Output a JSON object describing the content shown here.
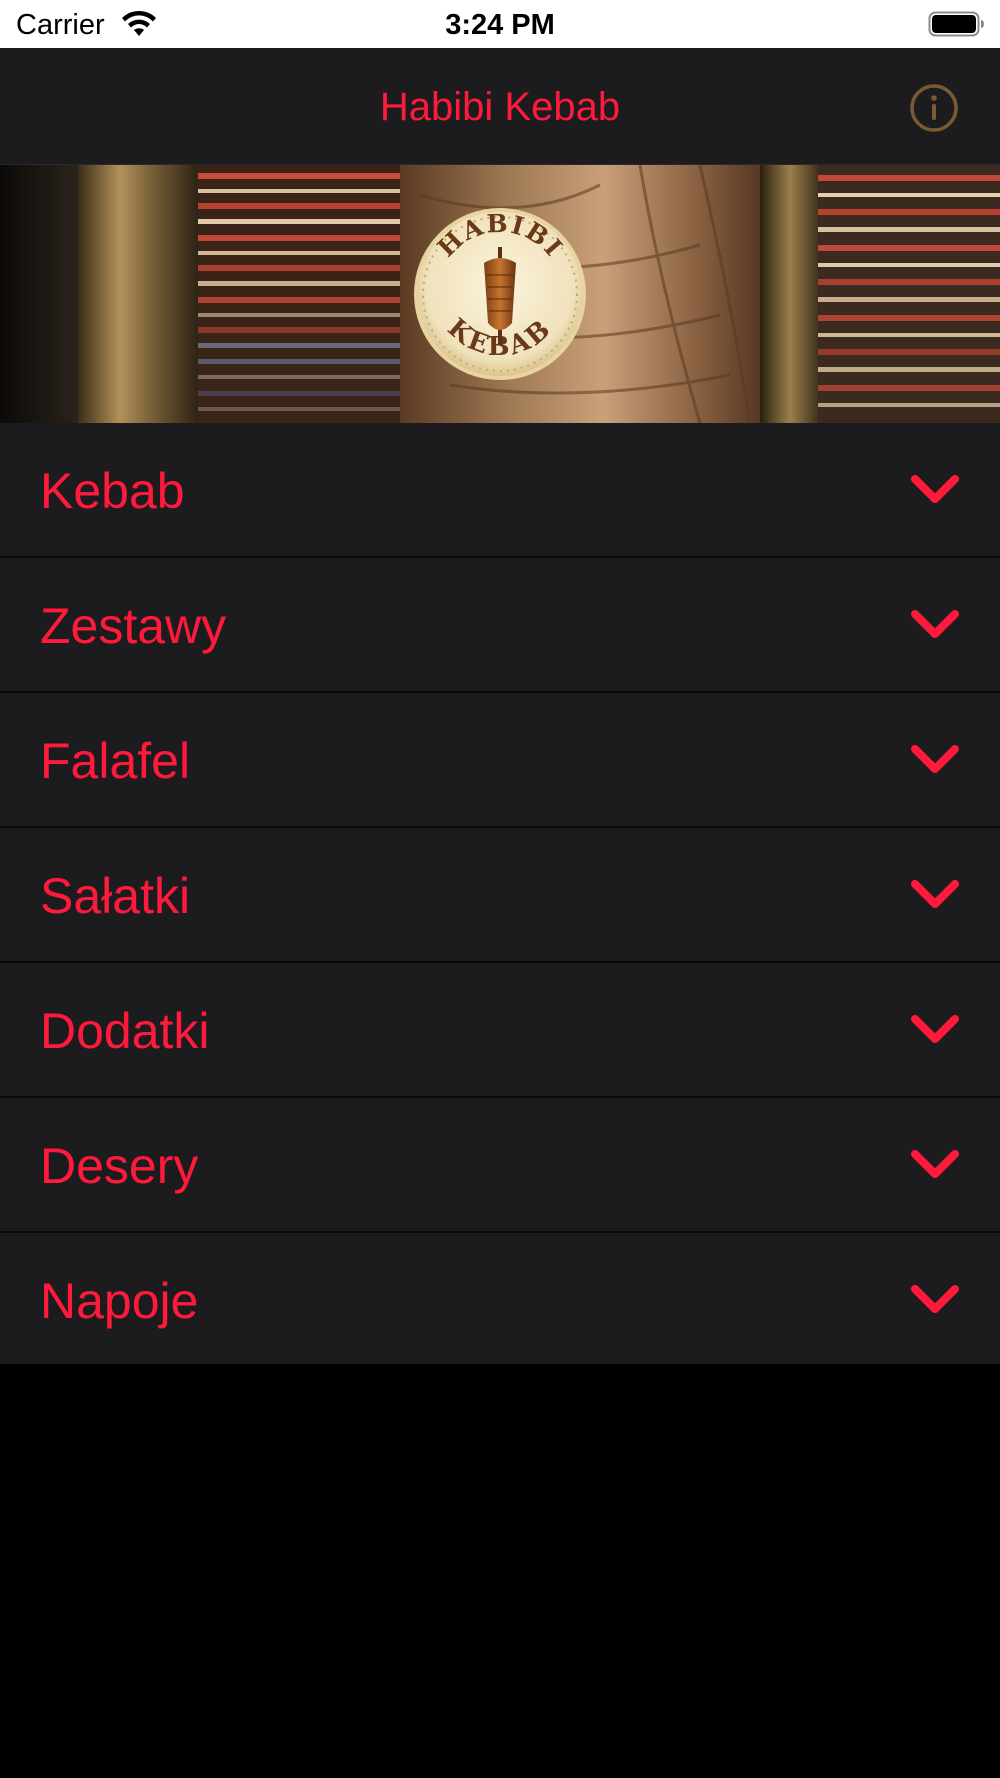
{
  "status_bar": {
    "carrier": "Carrier",
    "time": "3:24 PM",
    "wifi_icon": "wifi-icon",
    "battery_icon": "battery-full-icon"
  },
  "nav_bar": {
    "title": "Habibi Kebab",
    "info_icon": "info-circle-icon"
  },
  "banner": {
    "logo_top_text": "HABIBI",
    "logo_bottom_text": "KEBAB"
  },
  "menu": {
    "items": [
      {
        "label": "Kebab"
      },
      {
        "label": "Zestawy"
      },
      {
        "label": "Falafel"
      },
      {
        "label": "Sałatki"
      },
      {
        "label": "Dodatki"
      },
      {
        "label": "Desery"
      },
      {
        "label": "Napoje"
      }
    ],
    "expand_icon": "chevron-down-icon"
  },
  "colors": {
    "accent": "#ff1a3c",
    "cell_background": "#1c1c1e",
    "background": "#000000",
    "info_icon": "#7a5a33"
  }
}
